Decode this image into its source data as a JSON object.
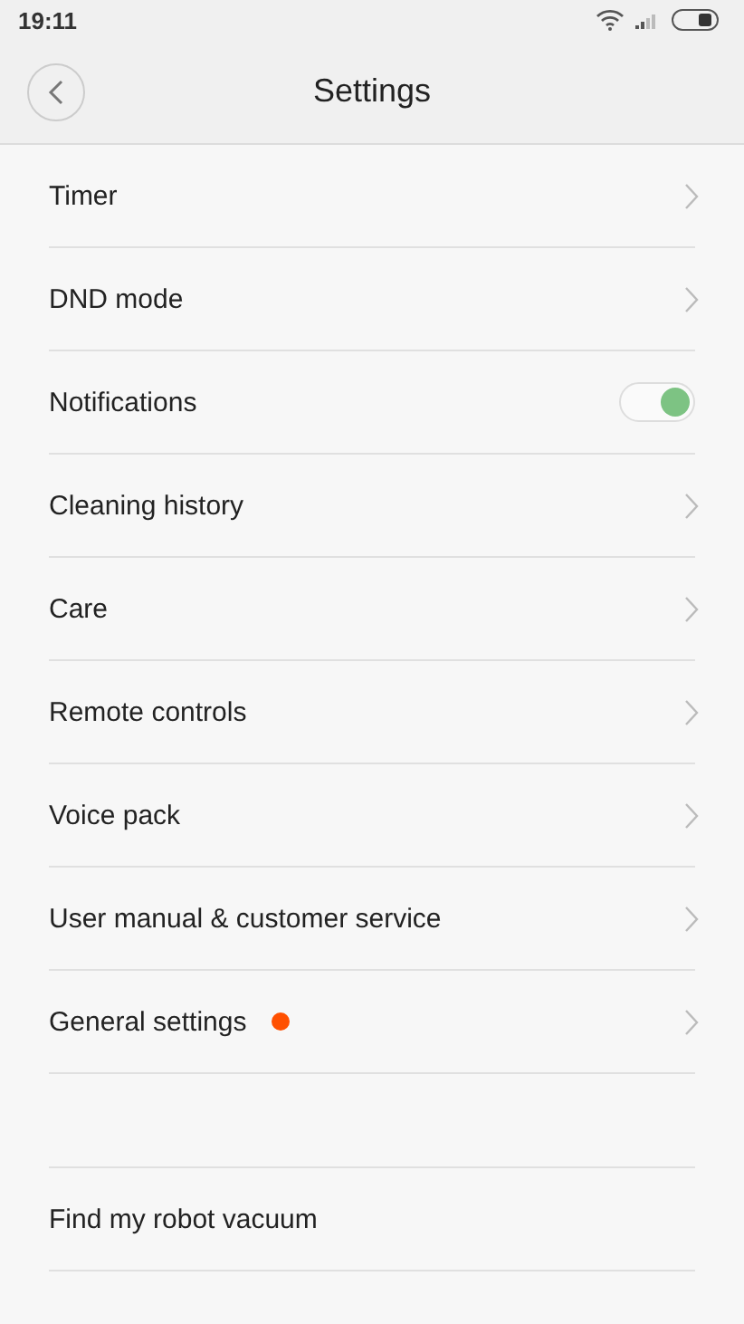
{
  "status_bar": {
    "time": "19:11"
  },
  "header": {
    "title": "Settings"
  },
  "items": [
    {
      "kind": "link",
      "label": "Timer"
    },
    {
      "kind": "link",
      "label": "DND mode"
    },
    {
      "kind": "toggle",
      "label": "Notifications",
      "on": true
    },
    {
      "kind": "link",
      "label": "Cleaning history"
    },
    {
      "kind": "link",
      "label": "Care"
    },
    {
      "kind": "link",
      "label": "Remote controls"
    },
    {
      "kind": "link",
      "label": "Voice pack"
    },
    {
      "kind": "link",
      "label": "User manual & customer service"
    },
    {
      "kind": "link",
      "label": "General settings",
      "color": "#ff5000"
    }
  ],
  "extra_items": [
    {
      "label": "Find my robot vacuum"
    }
  ]
}
